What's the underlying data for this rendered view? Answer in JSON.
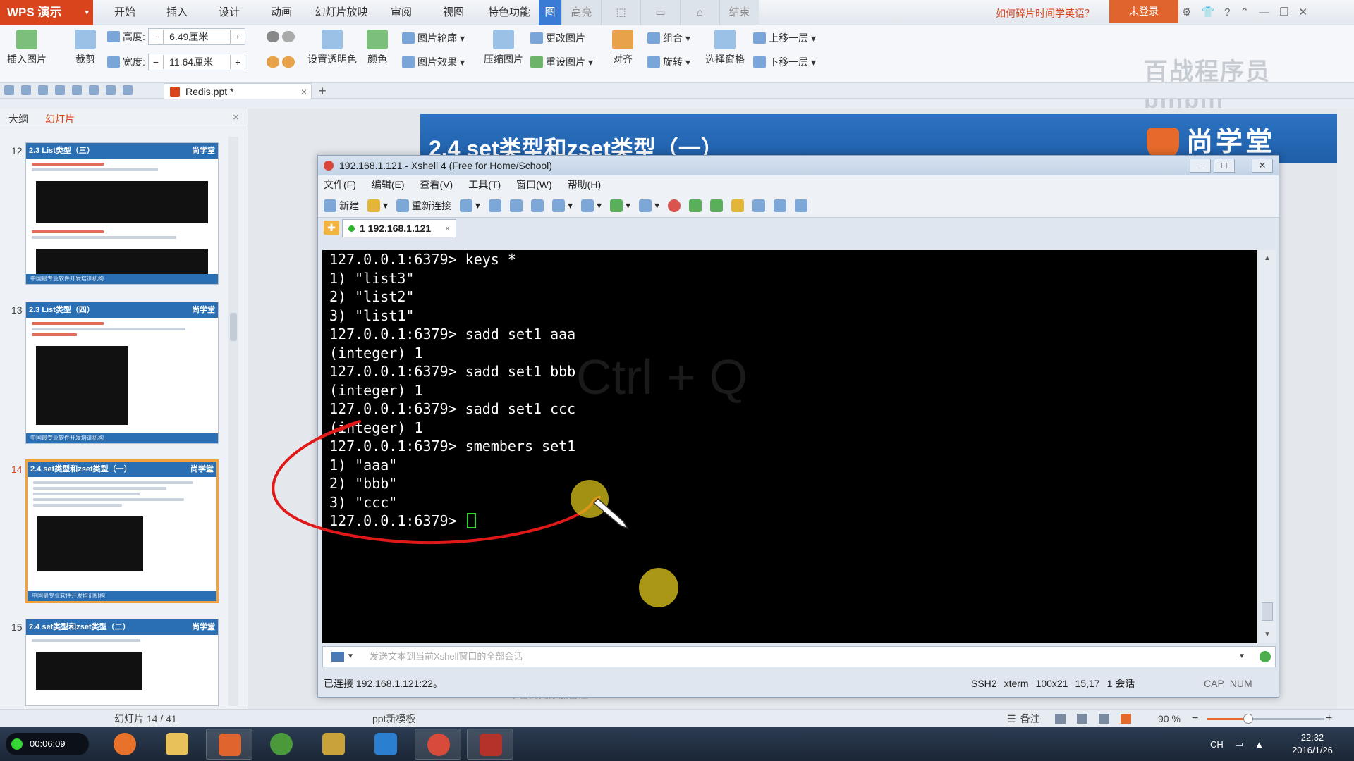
{
  "wps": {
    "app_name": "WPS 演示",
    "menu": [
      "开始",
      "插入",
      "设计",
      "动画",
      "幻灯片放映",
      "审阅",
      "视图",
      "特色功能",
      "图",
      "高亮",
      "",
      "",
      "",
      "结束"
    ],
    "help_link": "如何碎片时间学英语？",
    "login": "未登录",
    "watermark": "百战程序员 bilibili"
  },
  "ribbon": {
    "insert_picture": "插入图片",
    "crop": "裁剪",
    "height_label": "高度:",
    "height_value": "6.49厘米",
    "width_label": "宽度:",
    "width_value": "11.64厘米",
    "set_transparent": "设置透明色",
    "color": "颜色",
    "picture_outline": "图片轮廓",
    "picture_effect": "图片效果",
    "compress": "压缩图片",
    "change_picture": "更改图片",
    "reset_picture": "重设图片",
    "align": "对齐",
    "group": "组合",
    "rotate": "旋转",
    "selection_pane": "选择窗格",
    "bring_forward": "上移一层",
    "send_backward": "下移一层"
  },
  "doc_tab": {
    "title": "Redis.ppt *",
    "close": "×",
    "new": "+"
  },
  "left_panel": {
    "tab_outline": "大纲",
    "tab_slides": "幻灯片",
    "close": "×",
    "slides": [
      {
        "num": "12",
        "title": "2.3 List类型（三）",
        "logo": "尚学堂",
        "footer": "中国最专业软件开发培训机构"
      },
      {
        "num": "13",
        "title": "2.3 List类型（四）",
        "logo": "尚学堂",
        "footer": "中国最专业软件开发培训机构"
      },
      {
        "num": "14",
        "title": "2.4 set类型和zset类型（一）",
        "logo": "尚学堂",
        "footer": "中国最专业软件开发培训机构"
      },
      {
        "num": "15",
        "title": "2.4 set类型和zset类型（二）",
        "logo": "尚学堂",
        "footer": ""
      }
    ]
  },
  "slide": {
    "title": "2.4 set类型和zset类型（一）",
    "logo": "尚学堂",
    "notes_hint": "单击此处添加备注"
  },
  "xshell": {
    "title": "192.168.1.121 - Xshell 4 (Free for Home/School)",
    "menu": [
      "文件(F)",
      "编辑(E)",
      "查看(V)",
      "工具(T)",
      "窗口(W)",
      "帮助(H)"
    ],
    "toolbar": {
      "new": "新建",
      "reconnect": "重新连接"
    },
    "session_tab": "1 192.168.1.121",
    "session_close": "×",
    "terminal_lines": [
      "127.0.0.1:6379> keys *",
      "1) \"list3\"",
      "2) \"list2\"",
      "3) \"list1\"",
      "127.0.0.1:6379> sadd set1 aaa",
      "(integer) 1",
      "127.0.0.1:6379> sadd set1 bbb",
      "(integer) 1",
      "127.0.0.1:6379> sadd set1 ccc",
      "(integer) 1",
      "127.0.0.1:6379> smembers set1",
      "1) \"aaa\"",
      "2) \"bbb\"",
      "3) \"ccc\"",
      "127.0.0.1:6379> "
    ],
    "ghost_text": "Ctrl + Q",
    "send_placeholder": "发送文本到当前Xshell窗口的全部会话",
    "status": {
      "connected": "已连接 192.168.1.121:22。",
      "protocol": "SSH2",
      "term": "xterm",
      "size": "100x21",
      "pos": "15,17",
      "sessions": "1 会话",
      "caps": "CAP",
      "num": "NUM"
    }
  },
  "status_bar": {
    "slide_count": "幻灯片 14 / 41",
    "template": "ppt新模板",
    "notes": "备注",
    "zoom": "90 %",
    "zoom_level": 0.35
  },
  "taskbar": {
    "timer": "00:06:09",
    "tray_lang": "CH",
    "time": "22:32",
    "date": "2016/1/26"
  },
  "colors": {
    "wps_accent": "#d9441c",
    "slide_blue": "#2a6fb4",
    "terminal_bg": "#000000",
    "cursor_green": "#2fd52f",
    "annotation_red": "#e01818"
  }
}
